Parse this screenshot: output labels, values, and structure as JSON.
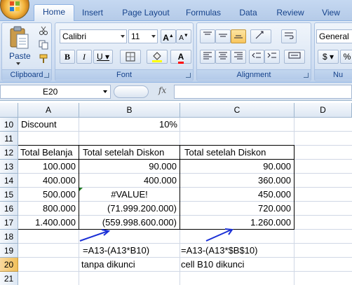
{
  "ribbon": {
    "tabs": [
      "Home",
      "Insert",
      "Page Layout",
      "Formulas",
      "Data",
      "Review",
      "View"
    ],
    "active_tab": "Home",
    "clipboard": {
      "paste_label": "Paste",
      "group_label": "Clipboard"
    },
    "font": {
      "name": "Calibri",
      "size": "11",
      "group_label": "Font",
      "highlight_color": "#ffff00",
      "font_color": "#ff0000"
    },
    "alignment": {
      "group_label": "Alignment"
    },
    "number": {
      "format": "General",
      "group_label": "Nu"
    }
  },
  "formula_bar": {
    "name_box": "E20",
    "fx_label": "fx",
    "formula": ""
  },
  "grid": {
    "columns": [
      "A",
      "B",
      "C",
      "D"
    ],
    "rows": [
      "10",
      "11",
      "12",
      "13",
      "14",
      "15",
      "16",
      "17",
      "18",
      "19",
      "20",
      "21"
    ],
    "selected_row": "20",
    "cells": {
      "a10": "Discount",
      "b10": "10%",
      "a12": "Total Belanja",
      "b12": "Total setelah Diskon",
      "c12": "Total setelah Diskon",
      "a13": "100.000",
      "b13": "90.000",
      "c13": "90.000",
      "a14": "400.000",
      "b14": "400.000",
      "c14": "360.000",
      "a15": "500.000",
      "b15": "#VALUE!",
      "c15": "450.000",
      "a16": "800.000",
      "b16": "(71.999.200.000)",
      "c16": "720.000",
      "a17": "1.400.000",
      "b17": "(559.998.600.000)",
      "c17": "1.260.000",
      "b19": "=A13-(A13*B10)",
      "c19": "=A13-(A13*$B$10)",
      "b20": "tanpa dikunci",
      "c20": "cell B10 dikunci"
    },
    "annotation_color": "#1a2fd6"
  }
}
